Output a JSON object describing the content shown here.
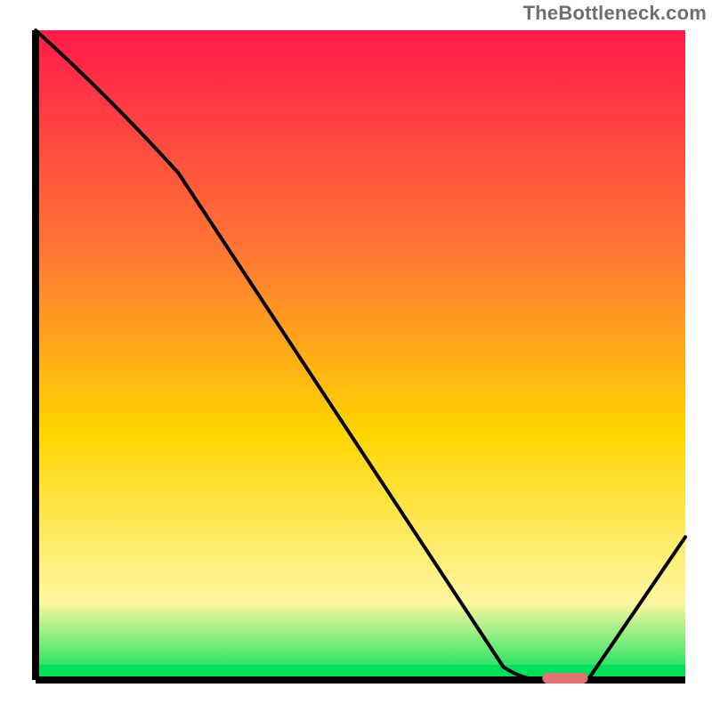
{
  "watermark": {
    "text": "TheBottleneck.com"
  },
  "colors": {
    "gradient_top": "#ff1a4b",
    "gradient_mid1": "#ff7a33",
    "gradient_mid2": "#ffd500",
    "gradient_low": "#fff7a0",
    "gradient_bottom": "#00e05a",
    "axis": "#000000",
    "curve": "#000000",
    "marker": "#e57373"
  },
  "chart_data": {
    "type": "line",
    "title": "",
    "xlabel": "",
    "ylabel": "",
    "x": [
      0,
      22,
      72,
      78,
      85,
      100
    ],
    "values": [
      100,
      78,
      2,
      0,
      0,
      22
    ],
    "ylim": [
      0,
      100
    ],
    "xlim": [
      0,
      100
    ],
    "marker": {
      "x_start": 78,
      "x_end": 85,
      "y": 0
    },
    "notes": "Values are read off as percentages of plot height/width; no numeric axis labels are shown in the source image."
  }
}
